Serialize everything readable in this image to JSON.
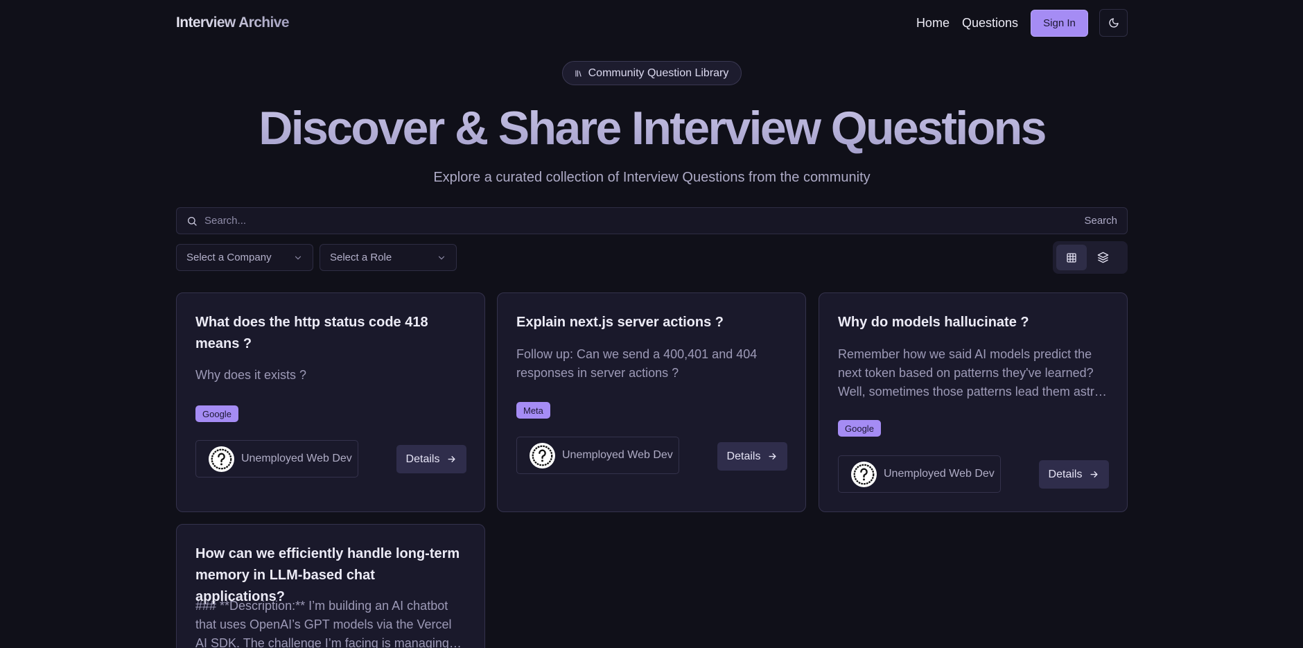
{
  "header": {
    "logo": "Interview Archive",
    "nav": {
      "home": "Home",
      "questions": "Questions"
    },
    "sign_in": "Sign In",
    "theme_icon": "moon-icon"
  },
  "hero": {
    "badge": "Community Question Library",
    "badge_icon": "library-icon",
    "title": "Discover & Share Interview Questions",
    "subtitle": "Explore a curated collection of Interview Questions from the community"
  },
  "search": {
    "placeholder": "Search...",
    "button": "Search"
  },
  "filters": {
    "company": "Select a Company",
    "role": "Select a Role"
  },
  "view_toggle": {
    "active": "grid",
    "options": [
      "grid-icon",
      "layers-icon"
    ]
  },
  "cards": [
    {
      "title": "What does the http status code 418 means ?",
      "description": "Why does it exists ?",
      "tag": "Google",
      "author": "Unemployed Web Dev",
      "details": "Details"
    },
    {
      "title": "Explain next.js server actions ?",
      "description": "Follow up: Can we send a 400,401 and 404 responses in server actions ?",
      "tag": "Meta",
      "author": "Unemployed Web Dev",
      "details": "Details"
    },
    {
      "title": "Why do models hallucinate ?",
      "description": "Remember how we said AI models predict the next token based on patterns they've learned? Well, sometimes those patterns lead them astray and they confidently produce information that isn't true.",
      "tag": "Google",
      "author": "Unemployed Web Dev",
      "details": "Details"
    },
    {
      "title": "How can we efficiently handle long-term memory in LLM-based chat applications?",
      "description": "### **Description:** I’m building an AI chatbot that uses OpenAI’s GPT models via the Vercel AI SDK. The challenge I’m facing is managing **long-term memory**",
      "tag": "",
      "author": "",
      "details": ""
    }
  ],
  "colors": {
    "background": "#101019",
    "card": "#1a192b",
    "accent": "#a58cf4",
    "border": "#34324c"
  }
}
